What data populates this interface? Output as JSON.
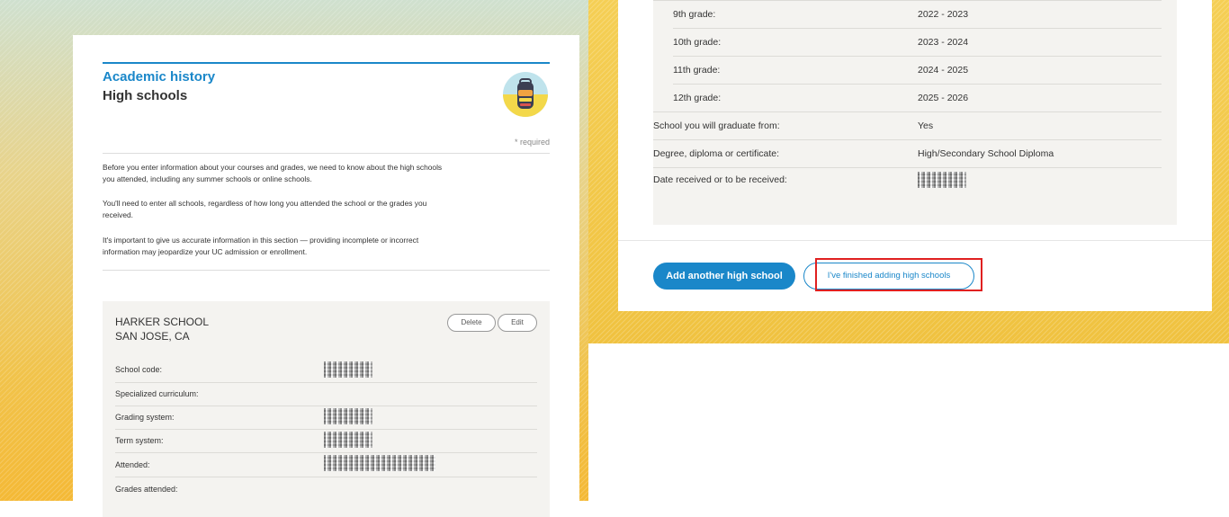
{
  "left": {
    "section_title": "Academic history",
    "section_subtitle": "High schools",
    "required_note": "* required",
    "paragraphs": [
      "Before you enter information about your courses and grades, we need to know about the high schools you attended, including any summer schools or online schools.",
      "You'll need to enter all schools, regardless of how long you attended the school or the grades you received.",
      "It's important to give us accurate information in this section — providing incomplete or incorrect information may jeopardize your UC admission or enrollment."
    ],
    "school": {
      "name": "HARKER SCHOOL",
      "location": "SAN JOSE, CA",
      "delete_label": "Delete",
      "edit_label": "Edit",
      "rows": [
        {
          "label": "School code:"
        },
        {
          "label": "Specialized curriculum:"
        },
        {
          "label": "Grading system:"
        },
        {
          "label": "Term system:"
        },
        {
          "label": "Attended:"
        },
        {
          "label": "Grades attended:"
        }
      ]
    },
    "badge_icon": "backpack-icon"
  },
  "right": {
    "grade_rows": [
      {
        "label": "9th grade:",
        "value": "2022 - 2023"
      },
      {
        "label": "10th grade:",
        "value": "2023 - 2024"
      },
      {
        "label": "11th grade:",
        "value": "2024 - 2025"
      },
      {
        "label": "12th grade:",
        "value": "2025 - 2026"
      }
    ],
    "info_rows": [
      {
        "label": "School you will graduate from:",
        "value": "Yes"
      },
      {
        "label": "Degree, diploma or certificate:",
        "value": "High/Secondary School Diploma"
      },
      {
        "label": "Date received or to be received:",
        "value": ""
      }
    ],
    "add_button": "Add another high school",
    "finish_button": "I've finished adding high schools"
  },
  "colors": {
    "accent": "#1a87c9",
    "highlight": "#e02020",
    "panel": "#f4f3f0"
  }
}
